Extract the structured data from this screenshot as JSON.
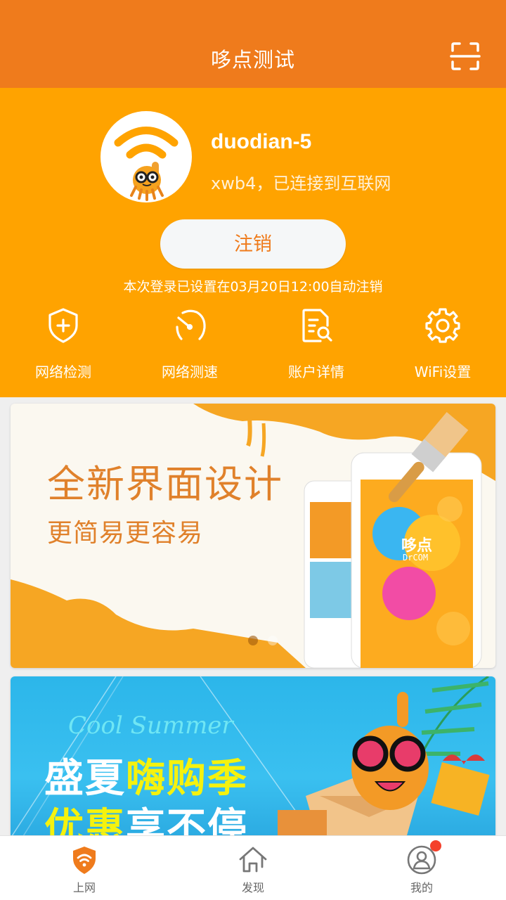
{
  "header": {
    "title": "哆点测试",
    "scan_icon": "scan-icon"
  },
  "connection": {
    "logo_icon": "wifi-mascot-logo",
    "ssid": "duodian-5",
    "status": "xwb4，已连接到互联网",
    "logout_label": "注销",
    "auto_logout_note": "本次登录已设置在03月20日12:00自动注销"
  },
  "actions": [
    {
      "label": "网络检测",
      "icon": "shield-plus-icon"
    },
    {
      "label": "网络测速",
      "icon": "speedometer-icon"
    },
    {
      "label": "账户详情",
      "icon": "document-search-icon"
    },
    {
      "label": "WiFi设置",
      "icon": "gear-icon"
    }
  ],
  "banners": [
    {
      "title": "全新界面设计",
      "subtitle": "更简易更容易",
      "phone_brand": "哆点",
      "phone_brand_en": "DrCOM",
      "carousel_index": 1,
      "carousel_count": 2
    },
    {
      "script_text": "Cool Summer",
      "line1_white": "盛夏",
      "line1_yellow": "嗨购季",
      "line2_yellow": "优惠",
      "line2_white": "享不停"
    }
  ],
  "tabs": [
    {
      "label": "上网",
      "icon": "wifi-shield-icon",
      "active": true
    },
    {
      "label": "发现",
      "icon": "home-icon",
      "active": false
    },
    {
      "label": "我的",
      "icon": "user-icon",
      "active": false,
      "badge": true
    }
  ],
  "colors": {
    "header": "#ef7b1c",
    "hero": "#ffa300",
    "accent": "#ef7b1c",
    "badge": "#f4412c",
    "tab_inactive": "#666666"
  }
}
